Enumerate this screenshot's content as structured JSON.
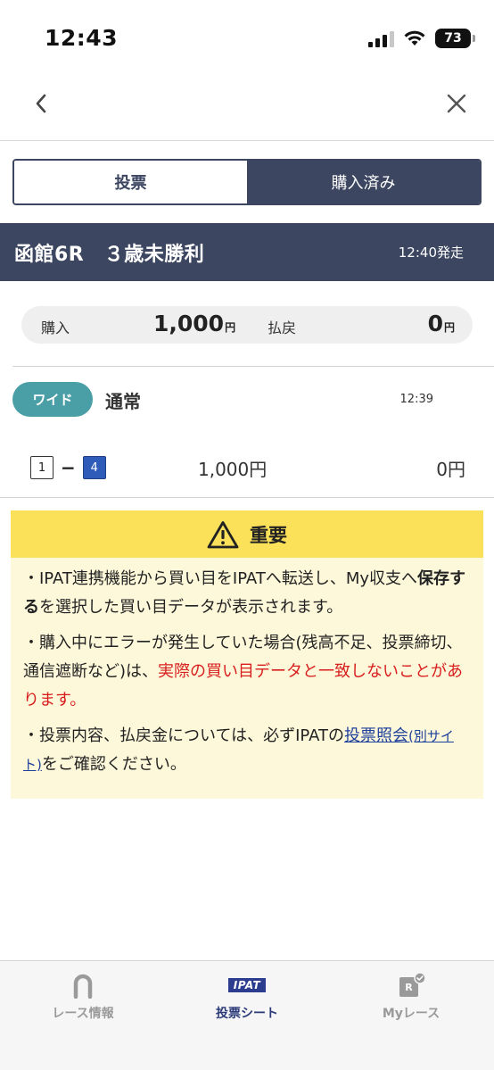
{
  "status_bar": {
    "time": "12:43",
    "battery": "73"
  },
  "nav": {
    "back_icon": "chevron-left-icon",
    "close_icon": "close-icon"
  },
  "tabs_top": [
    {
      "label": "投票",
      "selected": true
    },
    {
      "label": "購入済み",
      "selected": false
    }
  ],
  "race": {
    "title": "函館6R　３歳未勝利",
    "post_time": "12:40発走"
  },
  "summary": {
    "purchase_label": "購入",
    "purchase_amount": "1,000",
    "purchase_unit": "円",
    "payout_label": "払戻",
    "payout_amount": "0",
    "payout_unit": "円"
  },
  "bet": {
    "type": "ワイド",
    "mode": "通常",
    "time": "12:39",
    "combo": {
      "first": "1",
      "second": "4",
      "dash": "−"
    },
    "amount": "1,000円",
    "payout": "0円"
  },
  "notice": {
    "icon": "warning-icon",
    "title": "重要",
    "p1_a": "・IPAT連携機能から買い目をIPATへ転送し、My収支へ",
    "p1_bold": "保存する",
    "p1_b": "を選択した買い目データが表示されます。",
    "p2_a": "・購入中にエラーが発生していた場合(残高不足、投票締切、通信遮断など)は、",
    "p2_red": "実際の買い目データと一致しないことがあります。",
    "p3_a": "・投票内容、払戻金については、必ずIPATの",
    "p3_link": "投票照会",
    "p3_link_small": "(別サイト)",
    "p3_b": "をご確認ください。"
  },
  "tab_bar": [
    {
      "label": "レース情報",
      "icon": "horseshoe-icon",
      "active": false
    },
    {
      "label": "投票シート",
      "icon": "ipat-icon",
      "badge": "IPAT",
      "active": true
    },
    {
      "label": "Myレース",
      "icon": "my-race-icon",
      "badge": "R",
      "active": false
    }
  ],
  "colors": {
    "navy": "#3c4660",
    "teal": "#4a9ea6",
    "notice_header": "#fbe15a",
    "notice_bg": "#fdf8d9",
    "warning_red": "#d81e1e",
    "link_blue": "#1d3f9c"
  }
}
